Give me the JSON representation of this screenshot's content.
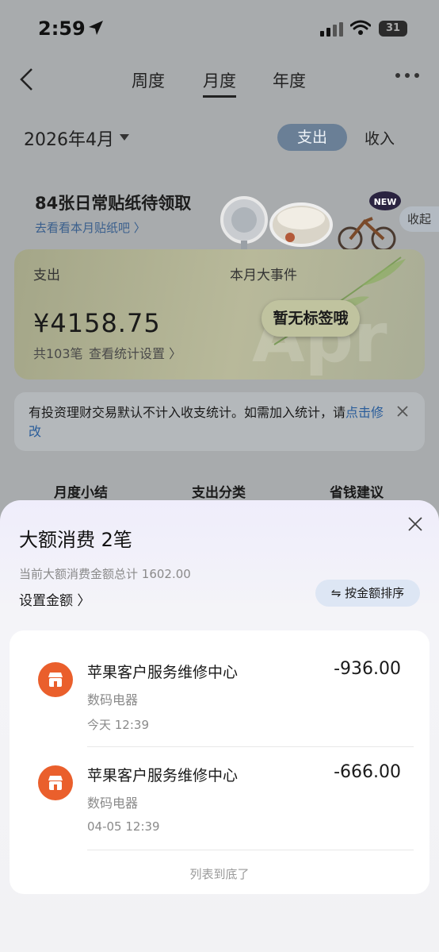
{
  "status_bar": {
    "time": "2:59",
    "battery": "31"
  },
  "nav": {
    "tabs": [
      "周度",
      "月度",
      "年度"
    ],
    "active_tab": "月度"
  },
  "filter": {
    "month": "2026年4月",
    "toggle_expense": "支出",
    "toggle_income": "收入"
  },
  "stickers": {
    "title": "84张日常贴纸待领取",
    "link": "去看看本月贴纸吧 〉",
    "collapse": "收起",
    "badge": "NEW"
  },
  "summary": {
    "expense_label": "支出",
    "events_label": "本月大事件",
    "amount": "¥4158.75",
    "count": "共103笔",
    "settings_link": "查看统计设置 〉",
    "no_tag": "暂无标签哦",
    "watermark": "Apr"
  },
  "notice": {
    "text": "有投资理财交易默认不计入收支统计。如需加入统计，请",
    "link": "点击修改"
  },
  "sections": [
    "月度小结",
    "支出分类",
    "省钱建议"
  ],
  "sheet": {
    "title": "大额消费 2笔",
    "total": "当前大额消费金额总计 1602.00",
    "set_amount": "设置金额 〉",
    "sort": "⇋ 按金额排序",
    "items": [
      {
        "name": "苹果客户服务维修中心",
        "amount": "-936.00",
        "category": "数码电器",
        "time": "今天 12:39"
      },
      {
        "name": "苹果客户服务维修中心",
        "amount": "-666.00",
        "category": "数码电器",
        "time": "04-05 12:39"
      }
    ],
    "end_text": "列表到底了"
  },
  "colors": {
    "accent": "#6a7f96",
    "merchant_icon": "#ea5f2c",
    "link": "#2a5d9a"
  }
}
